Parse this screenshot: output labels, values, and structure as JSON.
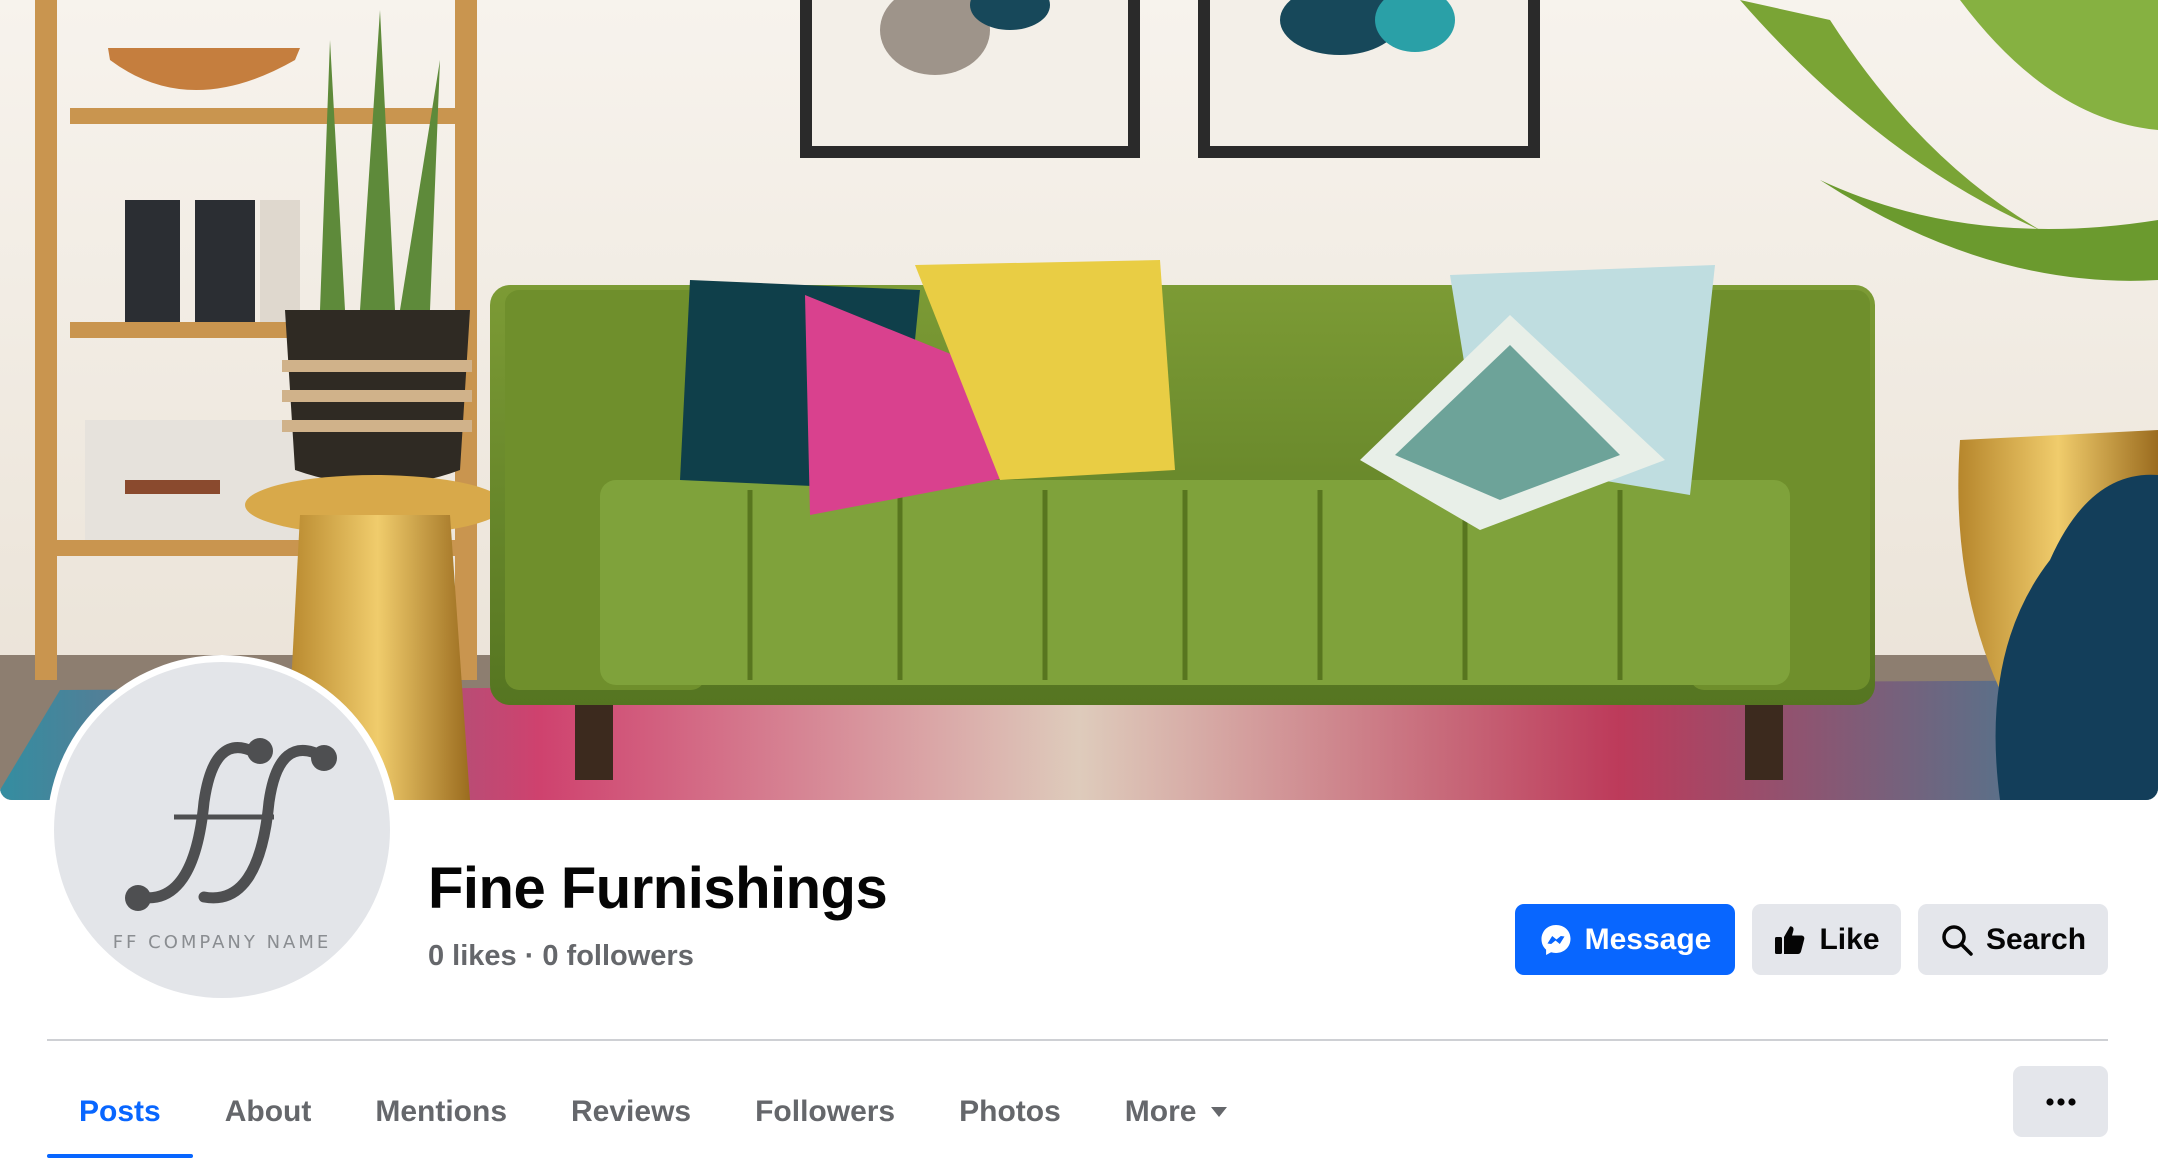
{
  "cover": {
    "image": "living-room-cover-photo",
    "description_icon": "cover-photo"
  },
  "profile": {
    "avatar_caption": "FF COMPANY NAME"
  },
  "page": {
    "name": "Fine Furnishings",
    "likes": "0 likes",
    "separator": "·",
    "followers": "0 followers"
  },
  "actions": {
    "message_label": "Message",
    "like_label": "Like",
    "search_label": "Search",
    "message_icon": "messenger-icon",
    "like_icon": "thumbs-up-icon",
    "search_icon": "search-icon",
    "more_icon": "more-dots-icon"
  },
  "tabs": [
    {
      "label": "Posts",
      "active": true
    },
    {
      "label": "About"
    },
    {
      "label": "Mentions"
    },
    {
      "label": "Reviews"
    },
    {
      "label": "Followers"
    },
    {
      "label": "Photos"
    },
    {
      "label": "More",
      "icon": "caret-down-icon"
    }
  ],
  "colors": {
    "primary": "#0866ff",
    "secondary_button": "#e4e6eb",
    "muted_text": "#65676b",
    "sofa_green": "#6f8f2c"
  }
}
